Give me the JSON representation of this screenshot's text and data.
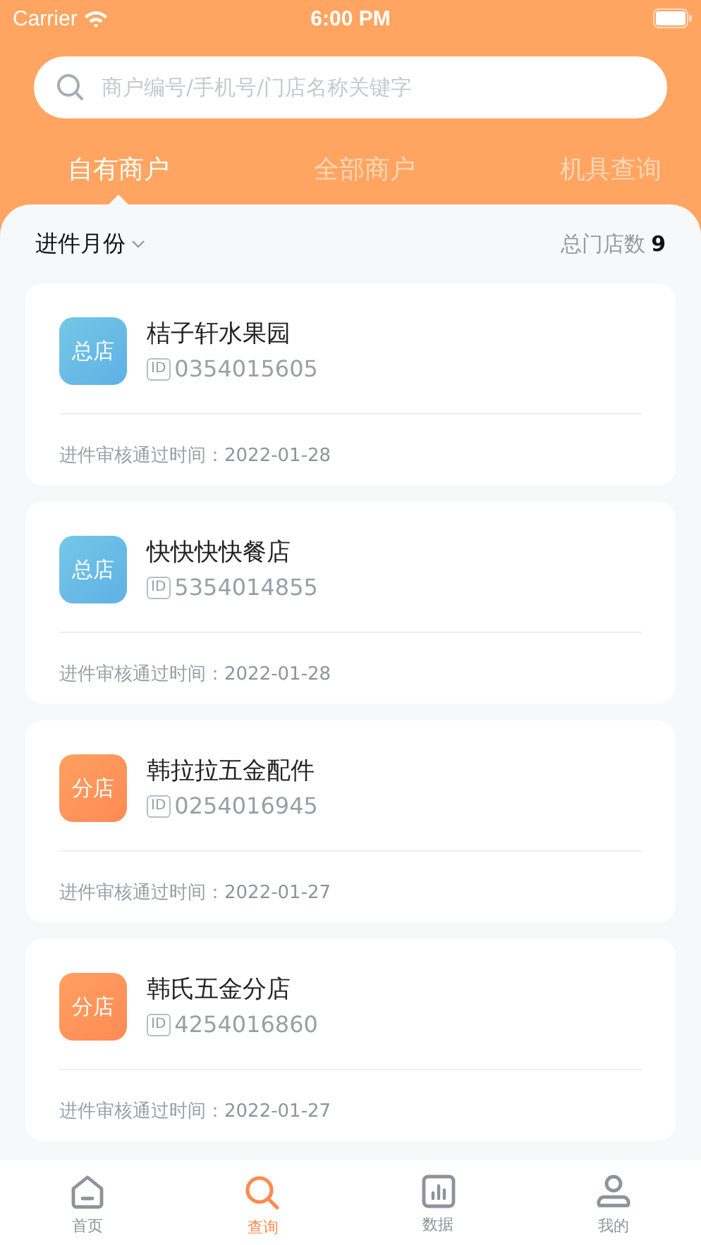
{
  "status_bar": {
    "carrier": "Carrier",
    "time": "6:00 PM"
  },
  "search": {
    "placeholder": "商户编号/手机号/门店名称关键字"
  },
  "tabs": [
    {
      "label": "自有商户",
      "selected": true
    },
    {
      "label": "全部商户",
      "selected": false
    },
    {
      "label": "机具查询",
      "selected": false
    }
  ],
  "filter": {
    "label": "进件月份",
    "total_label": "总门店数",
    "total": "9"
  },
  "merchants": [
    {
      "badge": "总店",
      "kind": "head",
      "name": "桔子轩水果园",
      "id_tag": "ID",
      "id": "0354015605",
      "date_label": "进件审核通过时间：",
      "date": "2022-01-28"
    },
    {
      "badge": "总店",
      "kind": "head",
      "name": "快快快快餐店",
      "id_tag": "ID",
      "id": "5354014855",
      "date_label": "进件审核通过时间：",
      "date": "2022-01-28"
    },
    {
      "badge": "分店",
      "kind": "branch",
      "name": "韩拉拉五金配件",
      "id_tag": "ID",
      "id": "0254016945",
      "date_label": "进件审核通过时间：",
      "date": "2022-01-27"
    },
    {
      "badge": "分店",
      "kind": "branch",
      "name": "韩氏五金分店",
      "id_tag": "ID",
      "id": "4254016860",
      "date_label": "进件审核通过时间：",
      "date": "2022-01-27"
    }
  ],
  "tab_bar": [
    {
      "label": "首页",
      "kind": "home",
      "selected": false
    },
    {
      "label": "查询",
      "kind": "search",
      "selected": true
    },
    {
      "label": "数据",
      "kind": "data",
      "selected": false
    },
    {
      "label": "我的",
      "kind": "profile",
      "selected": false
    }
  ]
}
